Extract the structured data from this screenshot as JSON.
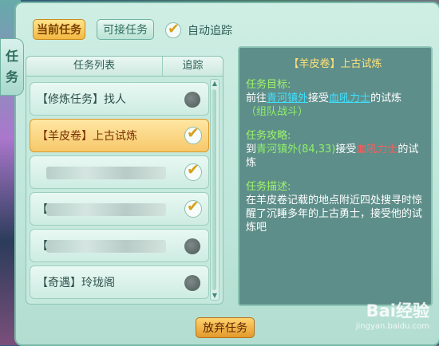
{
  "left_tab": {
    "chars": [
      "任",
      "务"
    ]
  },
  "tabs": {
    "current": "当前任务",
    "available": "可接任务"
  },
  "auto_track": {
    "label": "自动追踪",
    "checked": true
  },
  "list": {
    "header_name": "任务列表",
    "header_track": "追踪",
    "rows": [
      {
        "label": "【修炼任务】找人",
        "tracked": false,
        "selected": false
      },
      {
        "label": "【羊皮卷】上古试炼",
        "tracked": true,
        "selected": true
      },
      {
        "label": "",
        "tracked": true,
        "selected": false
      },
      {
        "label": "【",
        "tracked": true,
        "selected": false
      },
      {
        "label": "【",
        "tracked": false,
        "selected": false
      },
      {
        "label": "【奇遇】玲珑阁",
        "tracked": false,
        "selected": false
      }
    ]
  },
  "detail": {
    "title": "【羊皮卷】上古试炼",
    "goal_head": "任务目标:",
    "goal_pre": "前往",
    "goal_place": "青河镇外",
    "goal_mid": "接受",
    "goal_npc": "血吼力士",
    "goal_post": "的试炼",
    "goal_tag": "（组队战斗）",
    "guide_head": "任务攻略:",
    "guide_pre": "到",
    "guide_place": "青河镇外(84,33)",
    "guide_mid": "接受",
    "guide_npc": "血吼力士",
    "guide_post": "的试炼",
    "desc_head": "任务描述:",
    "desc_text": "在羊皮卷记载的地点附近四处搜寻时惊醒了沉睡多年的上古勇士，接受他的试炼吧"
  },
  "abandon_label": "放弃任务",
  "watermark": {
    "logo": "Bai经验",
    "url": "jingyan.baidu.com"
  },
  "colors": {
    "accent_gold": "#f3b843",
    "panel_teal": "#5e8e8a",
    "link_cyan": "#3fe0ff",
    "npc_red": "#ff5b5b",
    "section_green": "#9ef56b"
  }
}
